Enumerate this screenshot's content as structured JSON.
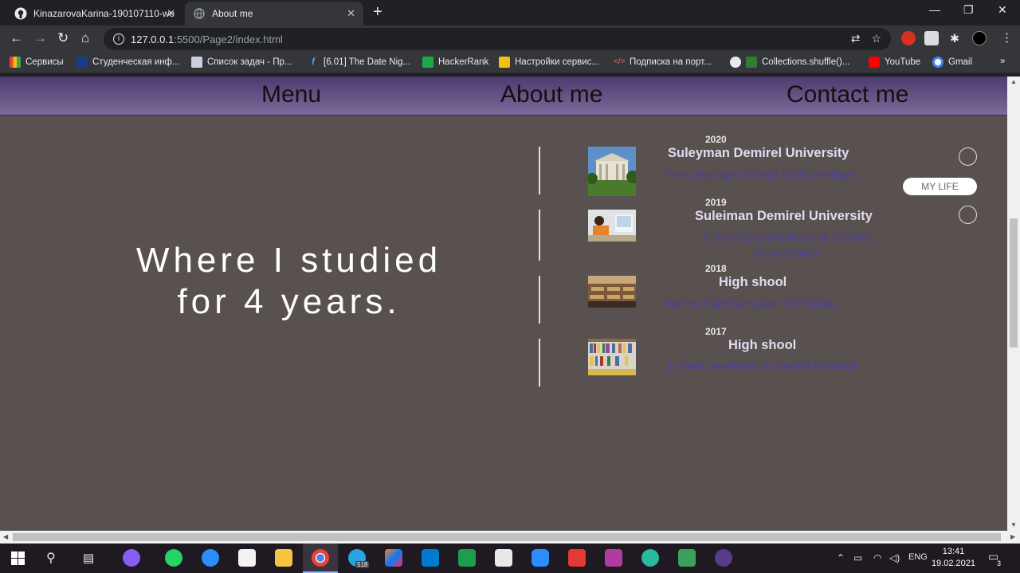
{
  "browser": {
    "tabs": [
      {
        "title": "KinazarovaKarina-190107110-we",
        "active": false
      },
      {
        "title": "About me",
        "active": true
      }
    ],
    "url_host": "127.0.0.1",
    "url_rest": ":5500/Page2/index.html",
    "bookmarks": [
      "Сервисы",
      "Студенческая инф...",
      "Список задач - Пр...",
      "[6.01] The Date Nig...",
      "HackerRank",
      "Настройки сервис...",
      "Подписка на порт...",
      "Collections.shuffle()...",
      "YouTube",
      "Gmail"
    ],
    "bookmarks_more": "»"
  },
  "page": {
    "nav": [
      "Menu",
      "About me",
      "Contact me"
    ],
    "headline_line1": "Where I studied",
    "headline_line2": "for 4 years.",
    "timeline": [
      {
        "year": "2020",
        "school": "Suleyman Demirel University",
        "role": "Team Manager & Front End Developer"
      },
      {
        "year": "2019",
        "school": "Suleiman Demirel University",
        "role": "Jr. Front End Developer & Content Administrator"
      },
      {
        "year": "2018",
        "school": "High shool",
        "role": "Internet Communication Technician"
      },
      {
        "year": "2017",
        "school": "High shool",
        "role": "Jr. Web Developer & Content Producer"
      }
    ],
    "my_life_button": "MY LIFE"
  },
  "taskbar": {
    "language": "ENG",
    "time": "13:41",
    "date": "19.02.2021",
    "notification_count": "3",
    "telegram_badge": "518"
  }
}
